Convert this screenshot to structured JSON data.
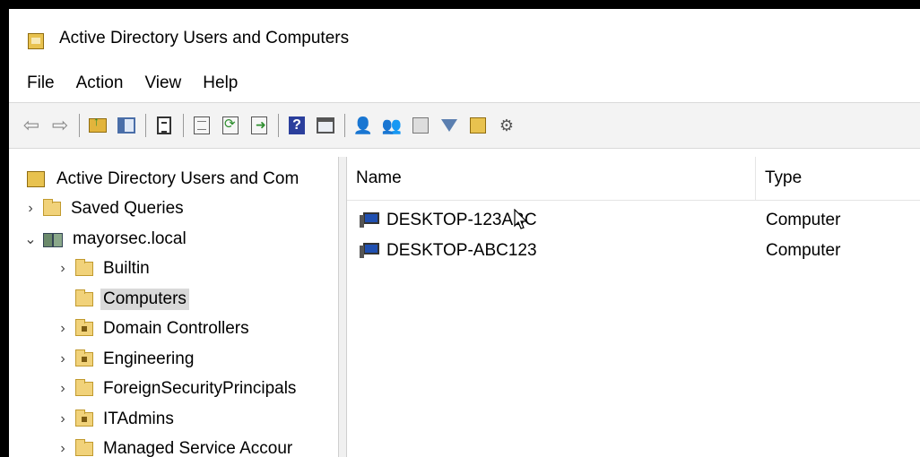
{
  "window": {
    "title": "Active Directory Users and Computers"
  },
  "menu": [
    "File",
    "Action",
    "View",
    "Help"
  ],
  "toolbar": {
    "icons": [
      "back-arrow-icon",
      "forward-arrow-icon",
      "up-one-level-icon",
      "show-hide-console-tree-icon",
      "clipboard-icon",
      "properties-icon",
      "refresh-icon",
      "export-list-icon",
      "help-icon",
      "show-action-pane-icon",
      "new-user-icon",
      "new-group-icon",
      "new-ou-icon",
      "filter-icon",
      "find-icon",
      "delegate-control-icon"
    ]
  },
  "tree": {
    "root": "Active Directory Users and Com",
    "saved_queries": "Saved Queries",
    "domain": "mayorsec.local",
    "children": [
      "Builtin",
      "Computers",
      "Domain Controllers",
      "Engineering",
      "ForeignSecurityPrincipals",
      "ITAdmins",
      "Managed Service Accour"
    ],
    "selected": "Computers"
  },
  "list": {
    "columns": [
      "Name",
      "Type"
    ],
    "rows": [
      {
        "name": "DESKTOP-123ABC",
        "type": "Computer"
      },
      {
        "name": "DESKTOP-ABC123",
        "type": "Computer"
      }
    ]
  }
}
